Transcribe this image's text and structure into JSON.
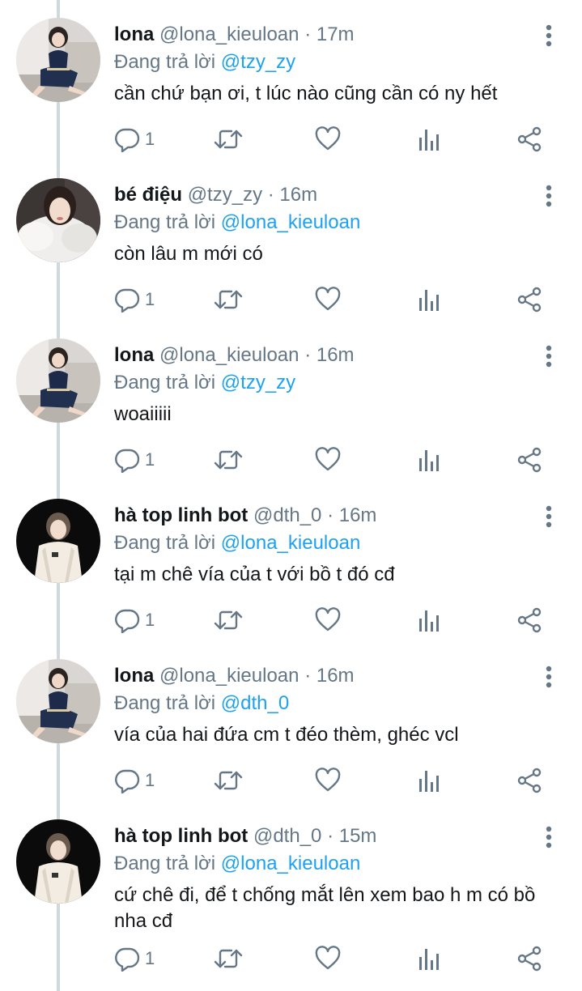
{
  "colors": {
    "mention": "#1da1f2",
    "secondary": "#657786",
    "text": "#14171a",
    "thread_line": "#cfd9de"
  },
  "icons": {
    "reply": "comment-icon",
    "retweet": "retweet-icon",
    "like": "heart-icon",
    "stats": "stats-icon",
    "share": "share-icon",
    "more": "more-vertical-icon"
  },
  "tweets": [
    {
      "name": "lona",
      "handle": "@lona_kieuloan",
      "sep": "·",
      "time": "17m",
      "reply_prefix": "Đang trả lời",
      "mention": "@tzy_zy",
      "text": "cần chứ bạn ơi, t lúc nào cũng cần có ny hết",
      "replies": "1",
      "avatar": "lona"
    },
    {
      "name": "bé điệu",
      "handle": "@tzy_zy",
      "sep": "·",
      "time": "16m",
      "reply_prefix": "Đang trả lời",
      "mention": "@lona_kieuloan",
      "text": "còn lâu m mới có",
      "replies": "1",
      "avatar": "bedieu"
    },
    {
      "name": "lona",
      "handle": "@lona_kieuloan",
      "sep": "·",
      "time": "16m",
      "reply_prefix": "Đang trả lời",
      "mention": "@tzy_zy",
      "text": "woaiiiii",
      "replies": "1",
      "avatar": "lona"
    },
    {
      "name": "hà top linh bot",
      "handle": "@dth_0",
      "sep": "·",
      "time": "16m",
      "reply_prefix": "Đang trả lời",
      "mention": "@lona_kieuloan",
      "text": "tại m chê vía của t với bồ t đó cđ",
      "replies": "1",
      "avatar": "ha"
    },
    {
      "name": "lona",
      "handle": "@lona_kieuloan",
      "sep": "·",
      "time": "16m",
      "reply_prefix": "Đang trả lời",
      "mention": "@dth_0",
      "text": "vía của hai đứa cm t đéo thèm, ghéc vcl",
      "replies": "1",
      "avatar": "lona"
    },
    {
      "name": "hà top linh bot",
      "handle": "@dth_0",
      "sep": "·",
      "time": "15m",
      "reply_prefix": "Đang trả lời",
      "mention": "@lona_kieuloan",
      "text": "cứ chê đi, để t chống mắt lên xem bao h m có bồ nha cđ",
      "replies": "1",
      "avatar": "ha"
    }
  ]
}
